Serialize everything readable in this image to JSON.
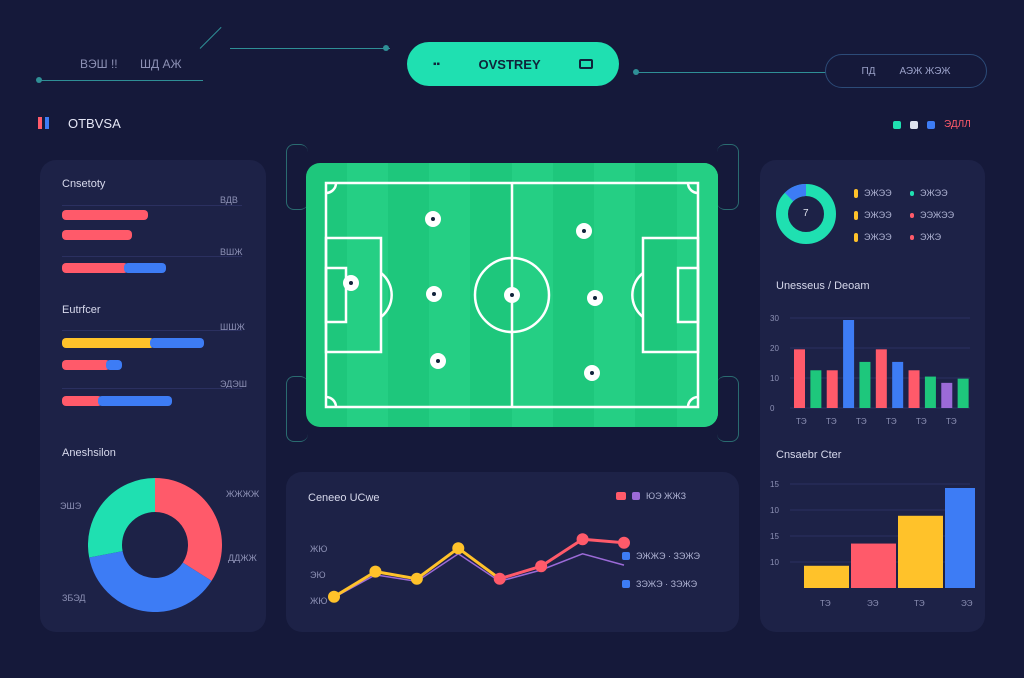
{
  "header": {
    "left_a": "ВЭШ !!",
    "left_b": "ШД АЖ",
    "center_button": "OVSTREY",
    "right_a": "ПД",
    "right_b": "АЭЖ ЖЭЖ"
  },
  "brand": {
    "title": "OTBVSA"
  },
  "top_right_legend": {
    "text": "ЭДЛЛ"
  },
  "left_panel": {
    "section1": {
      "title": "Cnsetoty",
      "v1": "ВДВ",
      "v2": "ВШЖ"
    },
    "section2": {
      "title": "Eutrfcer",
      "v1": "ШШЖ",
      "v2": "ЭДЭШ"
    },
    "section3": {
      "title": "Aneshsilon",
      "label_left": "ЭШЭ",
      "label_right_top": "ЖЖЖЖ",
      "label_right_mid": "ДДЖЖ",
      "label_bottom": "ЗБЭД"
    }
  },
  "donut_left": {
    "segments": [
      {
        "color": "#ff5a6a",
        "value": 34
      },
      {
        "color": "#3d7cf5",
        "value": 38
      },
      {
        "color": "#1fe0b1",
        "value": 28
      }
    ]
  },
  "center_line_panel": {
    "title": "Ceneeo UCwe",
    "legend_top": "ЮЭ ЖЖЗ",
    "legend_mid": "ЭЖЖЭ · ЗЭЖЭ",
    "legend_low": "ЗЭЖЭ · ЗЭЖЭ",
    "y_ticks": [
      "ЖЮ",
      "ЭЮ",
      "ЖЮ"
    ],
    "chart_data": {
      "type": "line",
      "x": [
        0,
        1,
        2,
        3,
        4,
        5,
        6,
        7
      ],
      "series": [
        {
          "color": "#ffc22a",
          "values": [
            8,
            36,
            28,
            62,
            28,
            42,
            62,
            48
          ]
        },
        {
          "color": "#ff5a6a",
          "values": [
            8,
            36,
            28,
            62,
            28,
            42,
            72,
            68
          ]
        }
      ]
    }
  },
  "right_panel": {
    "donut_small_label": "7",
    "legend": [
      {
        "color": "#ffc22a",
        "text": "ЭЖЭЭ",
        "color2": "#1fe0b1",
        "text2": "ЭЖЭЭ"
      },
      {
        "color": "#ffc22a",
        "text": "ЭЖЭЭ",
        "color2": "#ff5a6a",
        "text2": "ЭЭЖЭЭ"
      },
      {
        "color": "#ffc22a",
        "text": "ЭЖЭЭ",
        "color2": "#ff5a6a",
        "text2": "ЭЖЭ"
      }
    ],
    "bar1_title": "Unesseus / Deoam",
    "bar1_y": [
      "30",
      "20",
      "10",
      "0"
    ],
    "bar1_x": [
      "ТЭ",
      "ТЭ",
      "ТЭ",
      "ТЭ",
      "ТЭ",
      "ТЭ"
    ],
    "bar1": {
      "type": "bar",
      "values": [
        28,
        18,
        18,
        42,
        22,
        28,
        22,
        18,
        15,
        12,
        14
      ],
      "colors": [
        "#ff5a6a",
        "#1ec77c",
        "#ff5a6a",
        "#3d7cf5",
        "#1ec77c",
        "#ff5a6a",
        "#3d7cf5",
        "#ff5a6a",
        "#1ec77c",
        "#9b6ad7",
        "#1ec77c"
      ]
    },
    "bar2_title": "Cnsaebr Cter",
    "bar2_y": [
      "15",
      "10",
      "15",
      "10"
    ],
    "bar2_x": [
      "ТЭ",
      "ЭЭ",
      "ТЭ",
      "ЭЭ"
    ],
    "bar2": {
      "type": "bar",
      "values": [
        8,
        16,
        26,
        36
      ],
      "colors": [
        "#ffc22a",
        "#ff5a6a",
        "#ffc22a",
        "#3d7cf5"
      ]
    }
  }
}
